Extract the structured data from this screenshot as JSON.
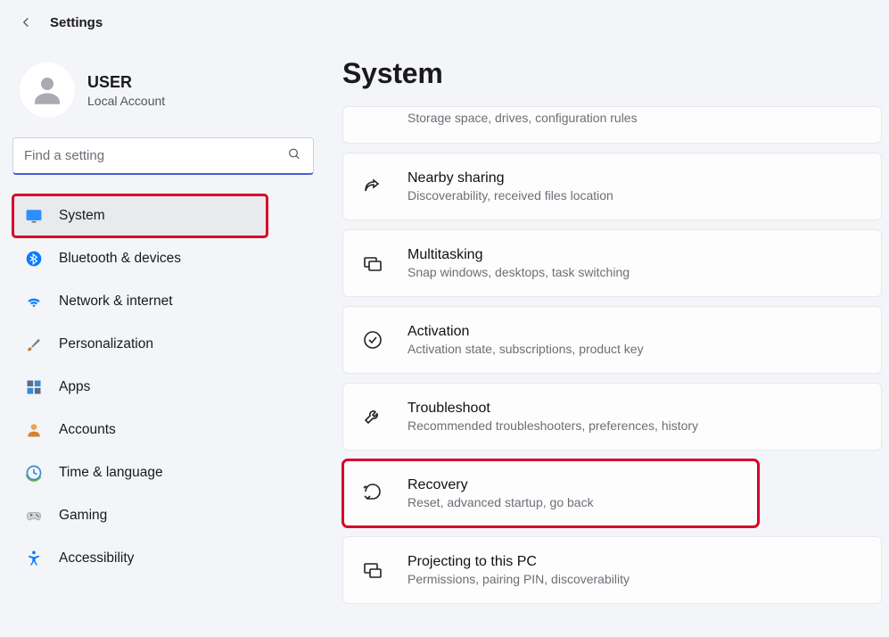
{
  "header": {
    "title": "Settings"
  },
  "account": {
    "name": "USER",
    "type": "Local Account"
  },
  "search": {
    "placeholder": "Find a setting"
  },
  "sidebar": {
    "items": [
      {
        "label": "System"
      },
      {
        "label": "Bluetooth & devices"
      },
      {
        "label": "Network & internet"
      },
      {
        "label": "Personalization"
      },
      {
        "label": "Apps"
      },
      {
        "label": "Accounts"
      },
      {
        "label": "Time & language"
      },
      {
        "label": "Gaming"
      },
      {
        "label": "Accessibility"
      }
    ]
  },
  "main": {
    "title": "System",
    "cards": [
      {
        "title": "",
        "desc": "Storage space, drives, configuration rules"
      },
      {
        "title": "Nearby sharing",
        "desc": "Discoverability, received files location"
      },
      {
        "title": "Multitasking",
        "desc": "Snap windows, desktops, task switching"
      },
      {
        "title": "Activation",
        "desc": "Activation state, subscriptions, product key"
      },
      {
        "title": "Troubleshoot",
        "desc": "Recommended troubleshooters, preferences, history"
      },
      {
        "title": "Recovery",
        "desc": "Reset, advanced startup, go back"
      },
      {
        "title": "Projecting to this PC",
        "desc": "Permissions, pairing PIN, discoverability"
      }
    ]
  }
}
